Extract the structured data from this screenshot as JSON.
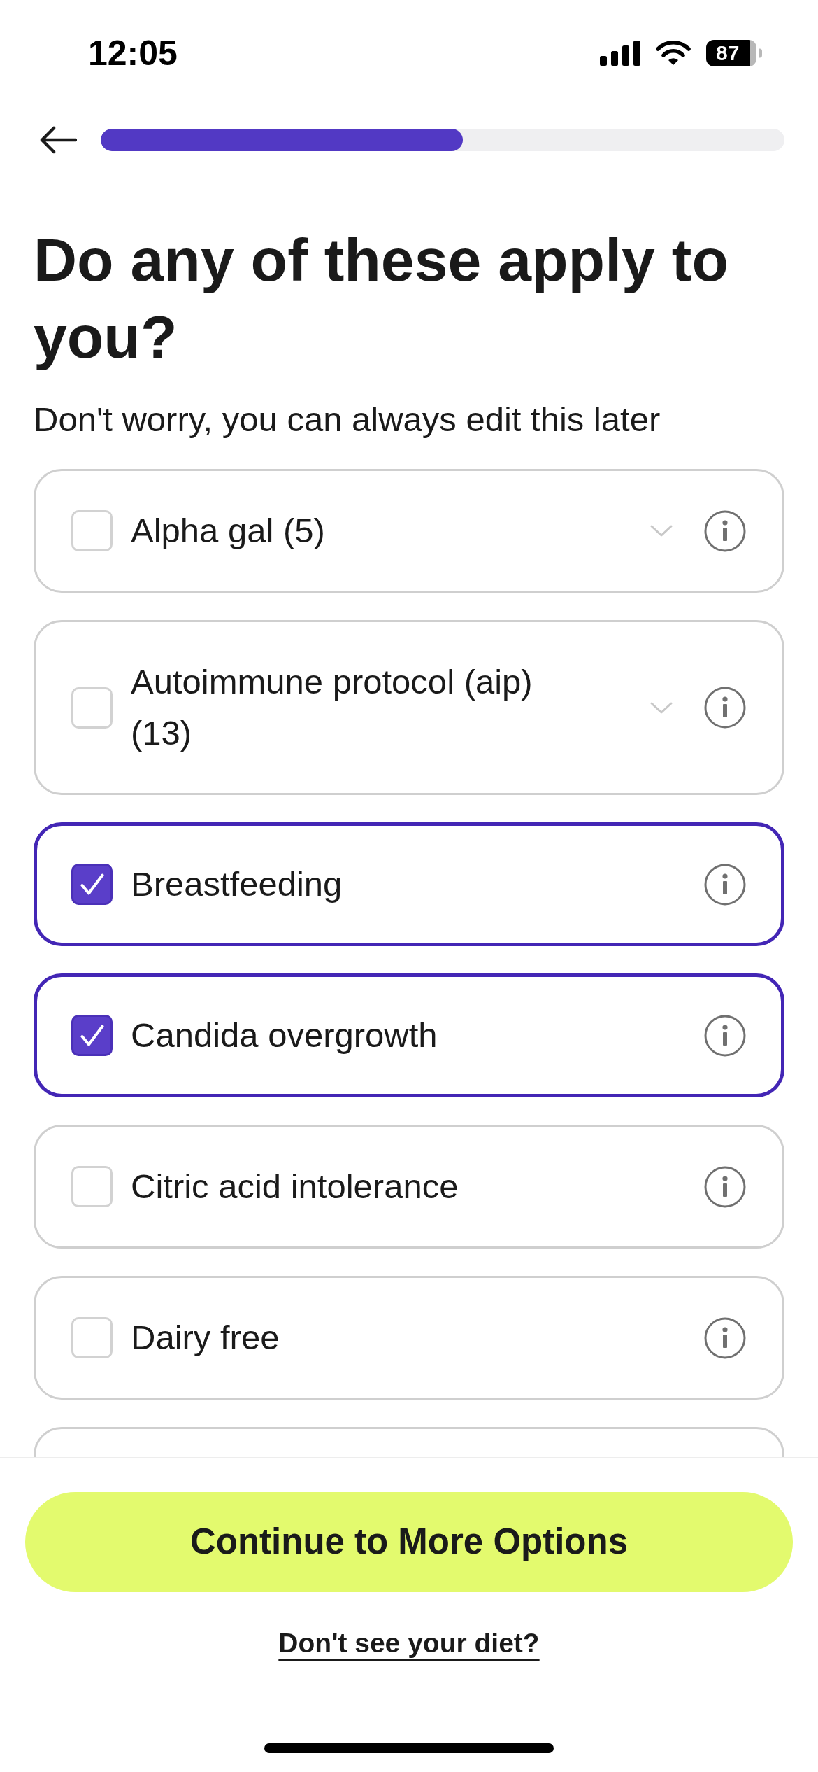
{
  "status_bar": {
    "time": "12:05",
    "battery": "87"
  },
  "header": {
    "progress": {
      "level": 0.53
    }
  },
  "title": "Do any of these apply to you?",
  "subtitle": "Don't worry, you can always edit this later",
  "options": [
    {
      "label": "Alpha gal (5)",
      "checked": false,
      "expandable": true
    },
    {
      "label": "Autoimmune protocol (aip) (13)",
      "checked": false,
      "expandable": true
    },
    {
      "label": "Breastfeeding",
      "checked": true,
      "expandable": false
    },
    {
      "label": "Candida overgrowth",
      "checked": true,
      "expandable": false
    },
    {
      "label": "Citric acid intolerance",
      "checked": false,
      "expandable": false
    },
    {
      "label": "Dairy free",
      "checked": false,
      "expandable": false
    }
  ],
  "footer": {
    "continue_button": "Continue to More Options",
    "help_link": "Don't see your diet?"
  }
}
